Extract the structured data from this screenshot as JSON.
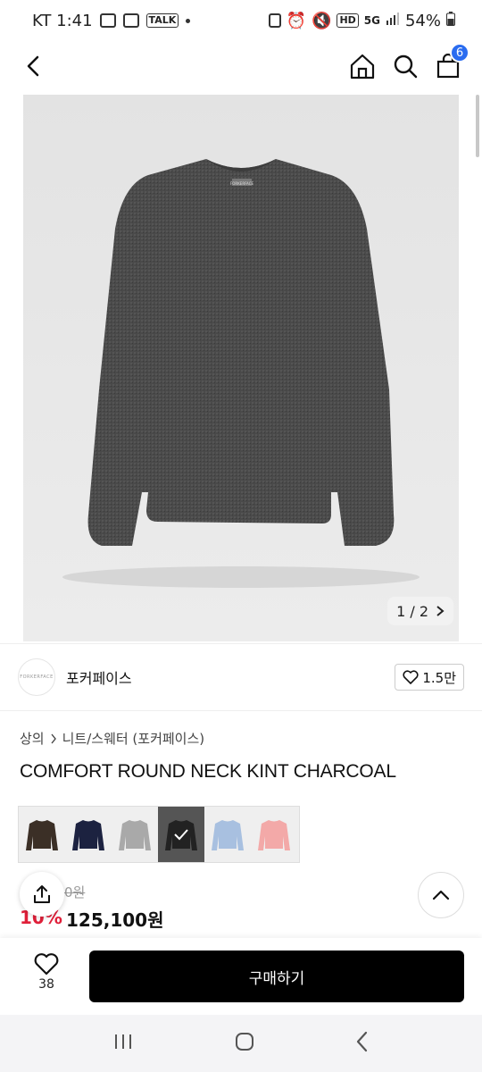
{
  "status_bar": {
    "carrier_time": "KT 1:41",
    "talk_label": "TALK",
    "hd_label": "HD",
    "network_label": "5G",
    "battery": "54%"
  },
  "header": {
    "cart_count": "6"
  },
  "image": {
    "pager": "1 / 2",
    "garment_label": "FORKERFACE"
  },
  "brand": {
    "logo_text": "FORKERFACE",
    "name": "포커페이스",
    "likes": "1.5만"
  },
  "breadcrumb": {
    "category": "상의",
    "subcategory": "니트/스웨터 (포커페이스)"
  },
  "product": {
    "title": "COMFORT ROUND NECK KINT CHARCOAL"
  },
  "swatches": [
    {
      "color": "#3b2f26",
      "selected": false
    },
    {
      "color": "#1c2240",
      "selected": false
    },
    {
      "color": "#a9a9a9",
      "selected": false
    },
    {
      "color": "#222222",
      "selected": true
    },
    {
      "color": "#a8c0e0",
      "selected": false
    },
    {
      "color": "#f3a9a8",
      "selected": false
    }
  ],
  "price": {
    "original": "0원",
    "discount": "10%",
    "sale": "125,100원"
  },
  "bottom": {
    "wish_count": "38",
    "buy_label": "구매하기"
  },
  "colors": {
    "accent_blue": "#2a6cf0",
    "discount_red": "#e0203a"
  }
}
